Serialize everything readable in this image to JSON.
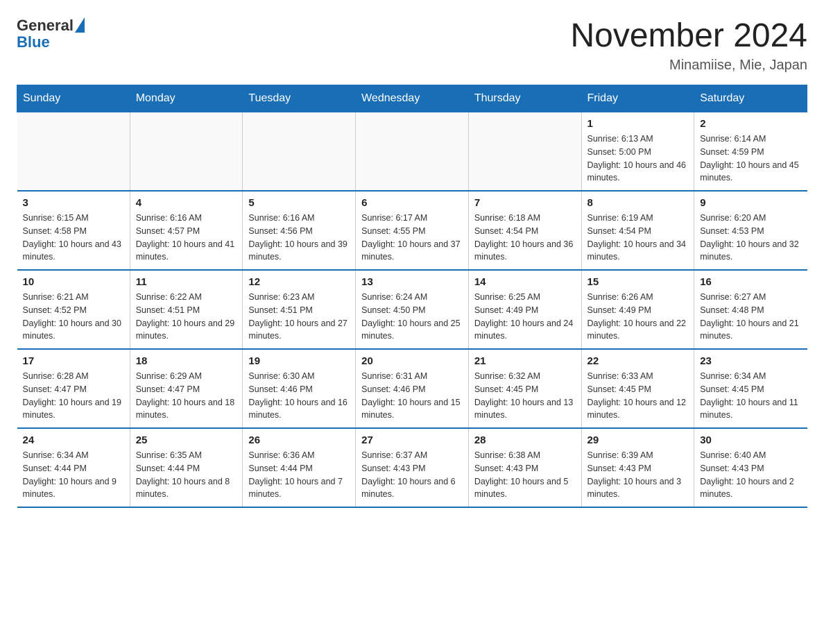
{
  "logo": {
    "general": "General",
    "blue": "Blue"
  },
  "header": {
    "month": "November 2024",
    "location": "Minamiise, Mie, Japan"
  },
  "weekdays": [
    "Sunday",
    "Monday",
    "Tuesday",
    "Wednesday",
    "Thursday",
    "Friday",
    "Saturday"
  ],
  "weeks": [
    [
      {
        "day": "",
        "info": ""
      },
      {
        "day": "",
        "info": ""
      },
      {
        "day": "",
        "info": ""
      },
      {
        "day": "",
        "info": ""
      },
      {
        "day": "",
        "info": ""
      },
      {
        "day": "1",
        "info": "Sunrise: 6:13 AM\nSunset: 5:00 PM\nDaylight: 10 hours and 46 minutes."
      },
      {
        "day": "2",
        "info": "Sunrise: 6:14 AM\nSunset: 4:59 PM\nDaylight: 10 hours and 45 minutes."
      }
    ],
    [
      {
        "day": "3",
        "info": "Sunrise: 6:15 AM\nSunset: 4:58 PM\nDaylight: 10 hours and 43 minutes."
      },
      {
        "day": "4",
        "info": "Sunrise: 6:16 AM\nSunset: 4:57 PM\nDaylight: 10 hours and 41 minutes."
      },
      {
        "day": "5",
        "info": "Sunrise: 6:16 AM\nSunset: 4:56 PM\nDaylight: 10 hours and 39 minutes."
      },
      {
        "day": "6",
        "info": "Sunrise: 6:17 AM\nSunset: 4:55 PM\nDaylight: 10 hours and 37 minutes."
      },
      {
        "day": "7",
        "info": "Sunrise: 6:18 AM\nSunset: 4:54 PM\nDaylight: 10 hours and 36 minutes."
      },
      {
        "day": "8",
        "info": "Sunrise: 6:19 AM\nSunset: 4:54 PM\nDaylight: 10 hours and 34 minutes."
      },
      {
        "day": "9",
        "info": "Sunrise: 6:20 AM\nSunset: 4:53 PM\nDaylight: 10 hours and 32 minutes."
      }
    ],
    [
      {
        "day": "10",
        "info": "Sunrise: 6:21 AM\nSunset: 4:52 PM\nDaylight: 10 hours and 30 minutes."
      },
      {
        "day": "11",
        "info": "Sunrise: 6:22 AM\nSunset: 4:51 PM\nDaylight: 10 hours and 29 minutes."
      },
      {
        "day": "12",
        "info": "Sunrise: 6:23 AM\nSunset: 4:51 PM\nDaylight: 10 hours and 27 minutes."
      },
      {
        "day": "13",
        "info": "Sunrise: 6:24 AM\nSunset: 4:50 PM\nDaylight: 10 hours and 25 minutes."
      },
      {
        "day": "14",
        "info": "Sunrise: 6:25 AM\nSunset: 4:49 PM\nDaylight: 10 hours and 24 minutes."
      },
      {
        "day": "15",
        "info": "Sunrise: 6:26 AM\nSunset: 4:49 PM\nDaylight: 10 hours and 22 minutes."
      },
      {
        "day": "16",
        "info": "Sunrise: 6:27 AM\nSunset: 4:48 PM\nDaylight: 10 hours and 21 minutes."
      }
    ],
    [
      {
        "day": "17",
        "info": "Sunrise: 6:28 AM\nSunset: 4:47 PM\nDaylight: 10 hours and 19 minutes."
      },
      {
        "day": "18",
        "info": "Sunrise: 6:29 AM\nSunset: 4:47 PM\nDaylight: 10 hours and 18 minutes."
      },
      {
        "day": "19",
        "info": "Sunrise: 6:30 AM\nSunset: 4:46 PM\nDaylight: 10 hours and 16 minutes."
      },
      {
        "day": "20",
        "info": "Sunrise: 6:31 AM\nSunset: 4:46 PM\nDaylight: 10 hours and 15 minutes."
      },
      {
        "day": "21",
        "info": "Sunrise: 6:32 AM\nSunset: 4:45 PM\nDaylight: 10 hours and 13 minutes."
      },
      {
        "day": "22",
        "info": "Sunrise: 6:33 AM\nSunset: 4:45 PM\nDaylight: 10 hours and 12 minutes."
      },
      {
        "day": "23",
        "info": "Sunrise: 6:34 AM\nSunset: 4:45 PM\nDaylight: 10 hours and 11 minutes."
      }
    ],
    [
      {
        "day": "24",
        "info": "Sunrise: 6:34 AM\nSunset: 4:44 PM\nDaylight: 10 hours and 9 minutes."
      },
      {
        "day": "25",
        "info": "Sunrise: 6:35 AM\nSunset: 4:44 PM\nDaylight: 10 hours and 8 minutes."
      },
      {
        "day": "26",
        "info": "Sunrise: 6:36 AM\nSunset: 4:44 PM\nDaylight: 10 hours and 7 minutes."
      },
      {
        "day": "27",
        "info": "Sunrise: 6:37 AM\nSunset: 4:43 PM\nDaylight: 10 hours and 6 minutes."
      },
      {
        "day": "28",
        "info": "Sunrise: 6:38 AM\nSunset: 4:43 PM\nDaylight: 10 hours and 5 minutes."
      },
      {
        "day": "29",
        "info": "Sunrise: 6:39 AM\nSunset: 4:43 PM\nDaylight: 10 hours and 3 minutes."
      },
      {
        "day": "30",
        "info": "Sunrise: 6:40 AM\nSunset: 4:43 PM\nDaylight: 10 hours and 2 minutes."
      }
    ]
  ]
}
